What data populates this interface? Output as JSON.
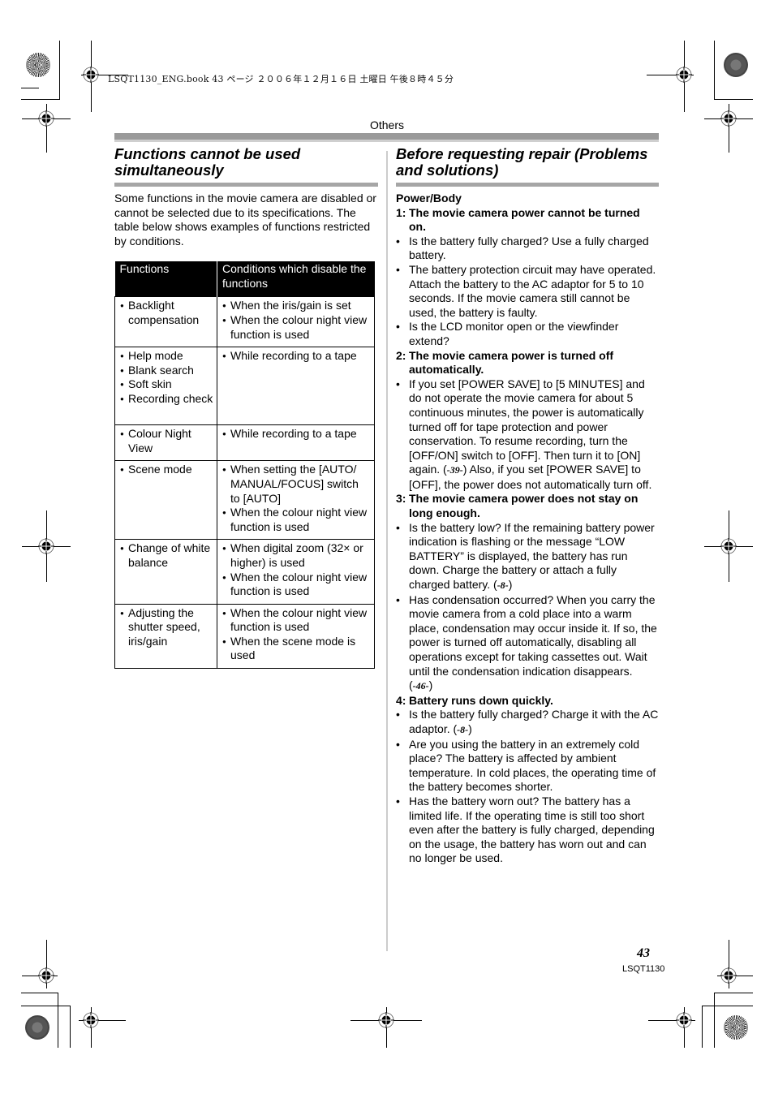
{
  "print_header": "LSQT1130_ENG.book  43 ページ  ２００６年１２月１６日  土曜日  午後８時４５分",
  "section_label": "Others",
  "left": {
    "title": "Functions cannot be used simultaneously",
    "intro": "Some functions in the movie camera are disabled or cannot be selected due to its specifications. The table below shows examples of functions restricted by conditions.",
    "table": {
      "headers": [
        "Functions",
        "Conditions which disable the functions"
      ],
      "rows": [
        {
          "functions": [
            "Backlight compensation"
          ],
          "conditions": [
            "When the iris/gain is set",
            "When the colour night view function is used"
          ]
        },
        {
          "functions": [
            "Help mode",
            "Blank search",
            "Soft skin",
            "Recording check"
          ],
          "conditions": [
            "While recording to a tape"
          ]
        },
        {
          "functions": [
            "Colour Night View"
          ],
          "conditions": [
            "While recording to a tape"
          ]
        },
        {
          "functions": [
            "Scene mode"
          ],
          "conditions": [
            "When setting the [AUTO/ MANUAL/FOCUS] switch to [AUTO]",
            "When the colour night view function is used"
          ]
        },
        {
          "functions": [
            "Change of white balance"
          ],
          "conditions": [
            "When digital zoom (32× or higher) is used",
            "When the colour night view function is used"
          ]
        },
        {
          "functions": [
            "Adjusting the shutter speed, iris/gain"
          ],
          "conditions": [
            "When the colour night view function is used",
            "When the scene mode is used"
          ]
        }
      ]
    }
  },
  "right": {
    "title": "Before requesting repair (Problems and solutions)",
    "subheading": "Power/Body",
    "problems": [
      {
        "num": "1:",
        "title": "The movie camera power cannot be turned on.",
        "bullets": [
          {
            "text": "Is the battery fully charged? Use a fully charged battery."
          },
          {
            "text": "The battery protection circuit may have operated. Attach the battery to the AC adaptor for 5 to 10 seconds. If the movie camera still cannot be used, the battery is faulty."
          },
          {
            "text": "Is the LCD monitor open or the viewfinder extend?"
          }
        ]
      },
      {
        "num": "2:",
        "title": "The movie camera power is turned off automatically.",
        "bullets": [
          {
            "text": "If you set [POWER SAVE] to [5 MINUTES] and do not operate the movie camera for about 5 continuous minutes, the power is automatically turned off for tape protection and power conservation. To resume recording, turn the [OFF/ON] switch to [OFF]. Then turn it to [ON] again. (",
            "ref": "-39-",
            "after": ") Also, if you set [POWER SAVE] to [OFF], the power does not automatically turn off."
          }
        ]
      },
      {
        "num": "3:",
        "title": "The movie camera power does not stay on long enough.",
        "bullets": [
          {
            "text": "Is the battery low? If the remaining battery power indication is flashing or the message “LOW BATTERY” is displayed, the battery has run down. Charge the battery or attach a fully charged battery. (",
            "ref": "-8-",
            "after": ")"
          },
          {
            "text": "Has condensation occurred? When you carry the movie camera from a cold place into a warm place, condensation may occur inside it. If so, the power is turned off automatically, disabling all operations except for taking cassettes out. Wait until the condensation indication disappears. (",
            "ref": "-46-",
            "after": ")"
          }
        ]
      },
      {
        "num": "4:",
        "title": "Battery runs down quickly.",
        "bullets": [
          {
            "text": "Is the battery fully charged? Charge it with the AC adaptor. (",
            "ref": "-8-",
            "after": ")"
          },
          {
            "text": "Are you using the battery in an extremely cold place? The battery is affected by ambient temperature. In cold places, the operating time of the battery becomes shorter."
          },
          {
            "text": "Has the battery worn out? The battery has a limited life. If the operating time is still too short even after the battery is fully charged, depending on the usage, the battery has worn out and can no longer be used."
          }
        ]
      }
    ]
  },
  "footer": {
    "page_number": "43",
    "model_code": "LSQT1130"
  }
}
